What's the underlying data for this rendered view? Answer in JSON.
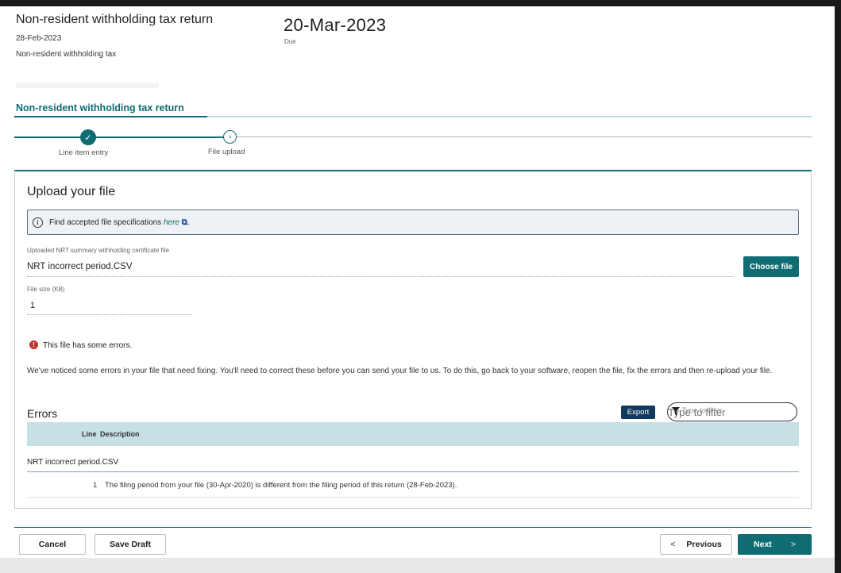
{
  "header": {
    "title": "Non-resident withholding tax return",
    "period_date": "28-Feb-2023",
    "tax_type": "Non-resident withholding tax",
    "due_date": "20-Mar-2023",
    "due_label": "Due"
  },
  "tab": {
    "label": "Non-resident withholding tax return"
  },
  "stepper": {
    "steps": [
      {
        "label": "Line item entry",
        "status": "complete"
      },
      {
        "label": "File upload",
        "status": "current"
      }
    ],
    "check_glyph": "✓",
    "current_glyph": "›"
  },
  "upload": {
    "heading": "Upload your file",
    "info_icon_glyph": "i",
    "info_prefix": "Find accepted file specifications ",
    "info_link": "here",
    "info_ext_glyph": "⧉",
    "info_suffix": ".",
    "file_label": "Uploaded NRT summary withholding certificate file",
    "file_value": "NRT incorrect period.CSV",
    "choose_button": "Choose file",
    "size_label": "File size (KB)",
    "size_value": "1"
  },
  "error_summary": {
    "icon_glyph": "!",
    "message": "This file has some errors.",
    "detail": "We've noticed some errors in your file that need fixing. You'll need to correct these before you can send your file to us. To do this, go back to your software, reopen the file, fix the errors and then re-upload your file."
  },
  "errors_table": {
    "heading": "Errors",
    "export_button": "Export",
    "filter_placeholder": "Type to filter",
    "columns": [
      "Line",
      "Description"
    ],
    "group": "NRT incorrect period.CSV",
    "rows": [
      {
        "line": "1",
        "description": "The filing period from your file (30-Apr-2020) is different from the filing period of this return (28-Feb-2023)."
      }
    ]
  },
  "footer": {
    "cancel": "Cancel",
    "save_draft": "Save Draft",
    "previous": "Previous",
    "previous_glyph": "<",
    "next": "Next",
    "next_glyph": ">"
  },
  "colors": {
    "accent": "#0f6c73",
    "navy": "#123a5e",
    "error": "#c0392b",
    "table_header": "#c6e0e3"
  }
}
